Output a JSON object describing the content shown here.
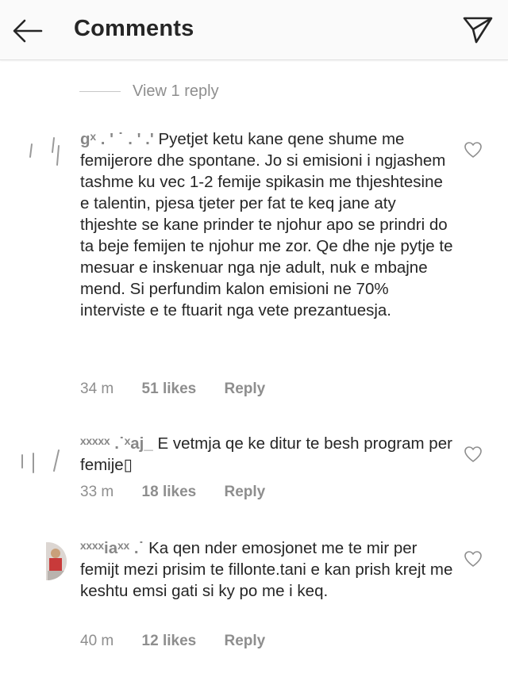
{
  "header": {
    "title": "Comments"
  },
  "view_replies": {
    "label": "View 1 reply"
  },
  "comments": [
    {
      "username": "gˣ . ' ˙ . ' .'",
      "text": "Pyetjet ketu kane qene shume me femijerore dhe spontane. Jo si emisioni i ngjashem tashme ku vec 1-2 femije spikasin me thjeshtesine e talentin, pjesa tjeter per fat te keq jane aty thjeshte se kane prinder te njohur apo se prindri do ta beje femijen te njohur me zor. Qe dhe nje pytje te mesuar e inskenuar nga nje adult, nuk e mbajne mend. Si perfundim kalon emisioni ne 70% interviste e te ftuarit nga vete prezantuesja.",
      "time": "34 m",
      "likes": "51 likes",
      "reply": "Reply"
    },
    {
      "username": "ˣˣˣˣˣ .˙ˣaj_",
      "text": "E vetmja qe ke ditur te besh program per femije▯",
      "time": "33 m",
      "likes": "18 likes",
      "reply": "Reply"
    },
    {
      "username": "ˣˣˣˣiaˣˣ .˙",
      "text": "Ka qen nder emosjonet me te mir per femijt mezi prisim te fillonte.tani e kan prish krejt me keshtu emsi gati si ky po me i keq.",
      "time": "40 m",
      "likes": "12 likes",
      "reply": "Reply"
    }
  ]
}
